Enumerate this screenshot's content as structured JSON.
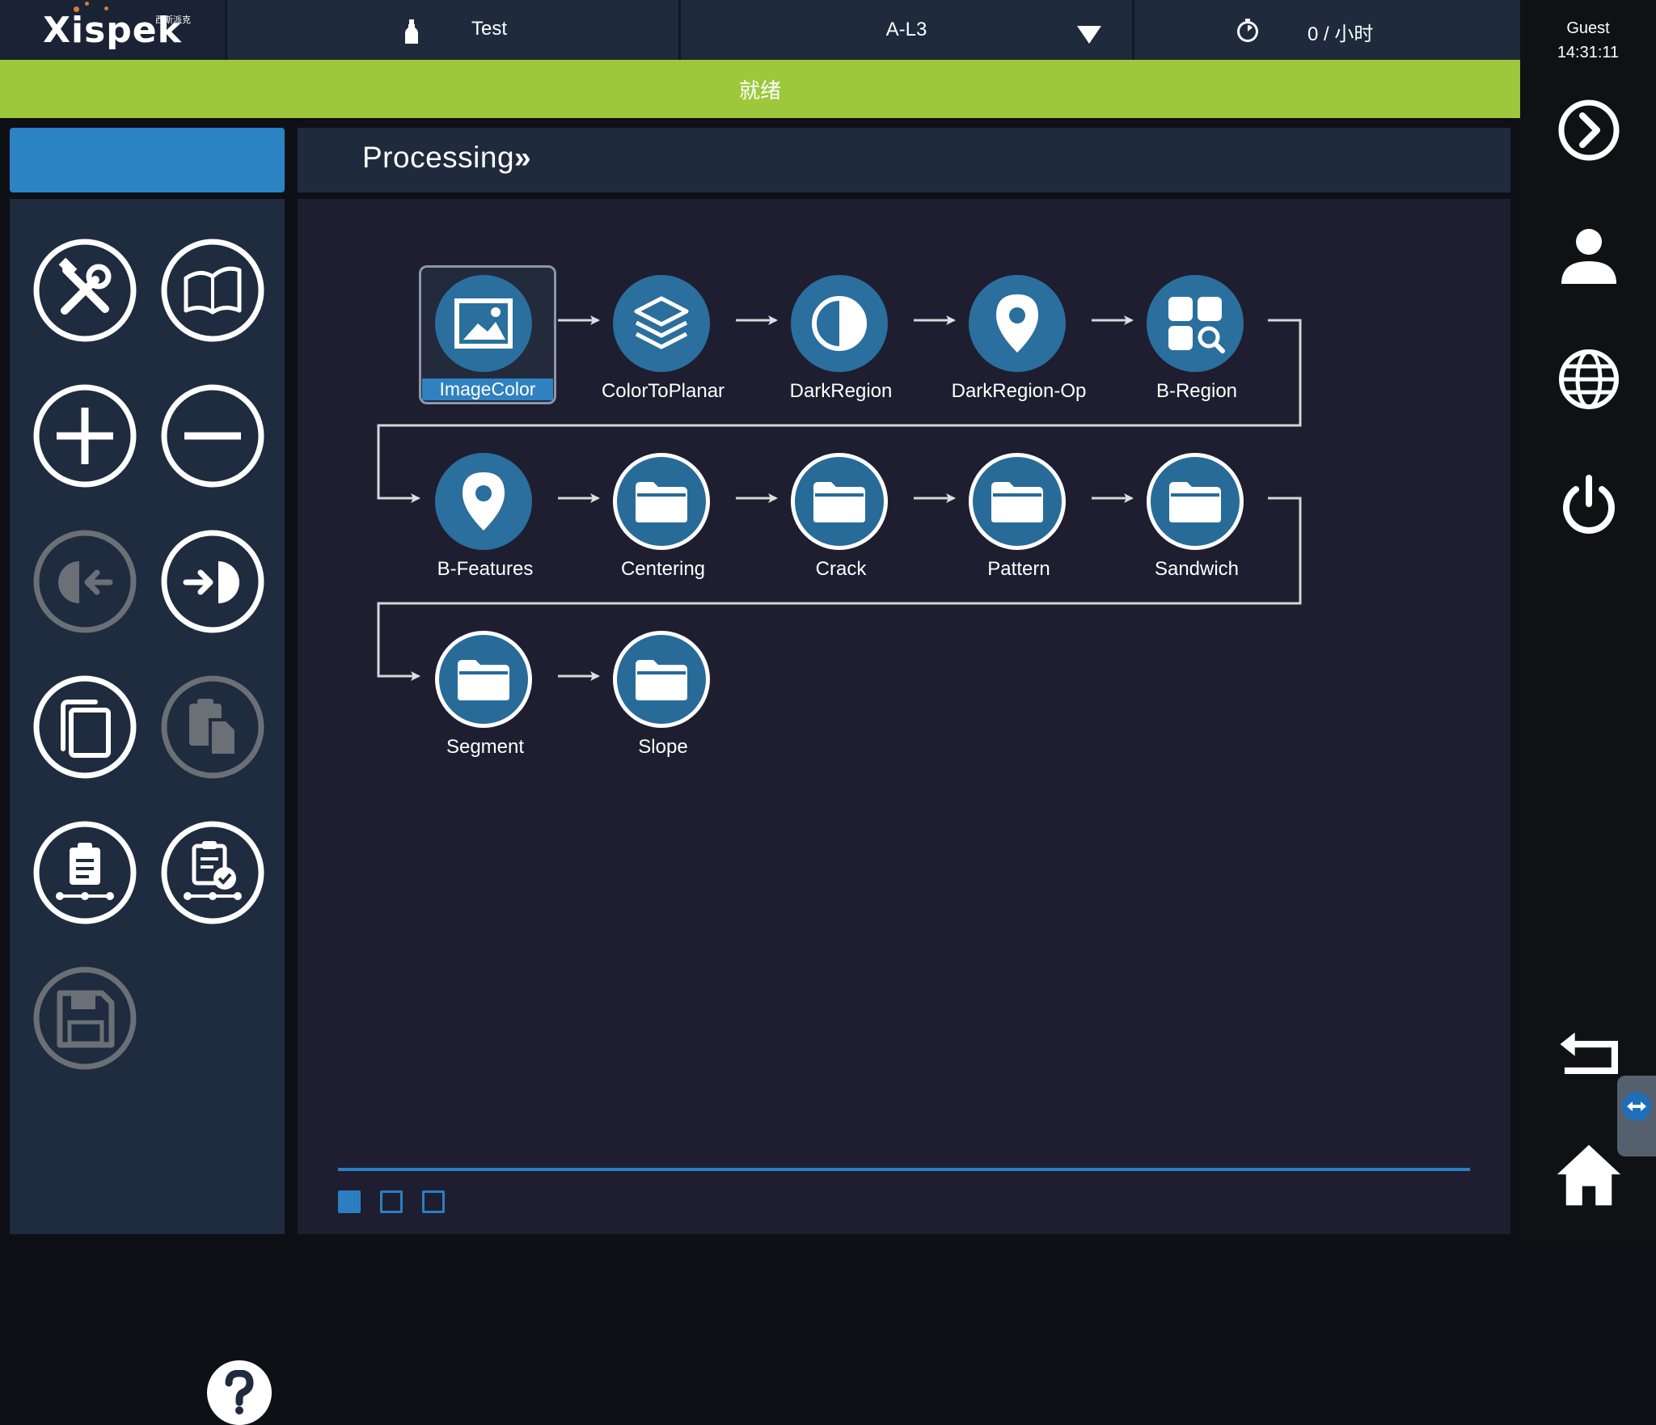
{
  "header": {
    "logo_text": "Xispek",
    "logo_subtext": "西斯派克",
    "recipe_name": "Test",
    "line_name": "A-L3",
    "rate_text": "0 / 小时"
  },
  "status": {
    "text": "就绪"
  },
  "user": {
    "name": "Guest",
    "time": "14:31:11"
  },
  "main": {
    "title": "Processing",
    "title_suffix": "»",
    "nodes": [
      {
        "label": "ImageColor",
        "icon": "image-icon",
        "selected": true
      },
      {
        "label": "ColorToPlanar",
        "icon": "layers-icon"
      },
      {
        "label": "DarkRegion",
        "icon": "half-circle-icon"
      },
      {
        "label": "DarkRegion-Op",
        "icon": "location-pin-icon"
      },
      {
        "label": "B-Region",
        "icon": "grid-search-icon"
      },
      {
        "label": "B-Features",
        "icon": "location-pin-icon"
      },
      {
        "label": "Centering",
        "icon": "folder-icon"
      },
      {
        "label": "Crack",
        "icon": "folder-icon"
      },
      {
        "label": "Pattern",
        "icon": "folder-icon"
      },
      {
        "label": "Sandwich",
        "icon": "folder-icon"
      },
      {
        "label": "Segment",
        "icon": "folder-icon"
      },
      {
        "label": "Slope",
        "icon": "folder-icon"
      }
    ],
    "pages": {
      "count": 3,
      "active": 1
    }
  },
  "toolbar": {
    "tools": [
      {
        "icon": "tools-icon",
        "enabled": true
      },
      {
        "icon": "open-book-icon",
        "enabled": true
      },
      {
        "icon": "plus-icon",
        "enabled": true
      },
      {
        "icon": "minus-icon",
        "enabled": true
      },
      {
        "icon": "move-left-icon",
        "enabled": false
      },
      {
        "icon": "move-right-icon",
        "enabled": true
      },
      {
        "icon": "copy-icon",
        "enabled": true
      },
      {
        "icon": "paste-icon",
        "enabled": false
      },
      {
        "icon": "clipboard-flow-icon",
        "enabled": true
      },
      {
        "icon": "clipboard-check-icon",
        "enabled": true
      },
      {
        "icon": "save-icon",
        "enabled": false
      }
    ],
    "help_icon": "question-icon"
  },
  "rail": {
    "icons": [
      "chevron-right-circle-icon",
      "user-icon",
      "globe-icon",
      "power-icon",
      "back-icon",
      "remote-icon",
      "home-icon"
    ]
  },
  "colors": {
    "status_green": "#9dc83c",
    "accent_blue": "#2b83c4",
    "node_blue": "#2a6f9d",
    "panel": "#1f2b3e",
    "canvas": "#1e1e30"
  }
}
